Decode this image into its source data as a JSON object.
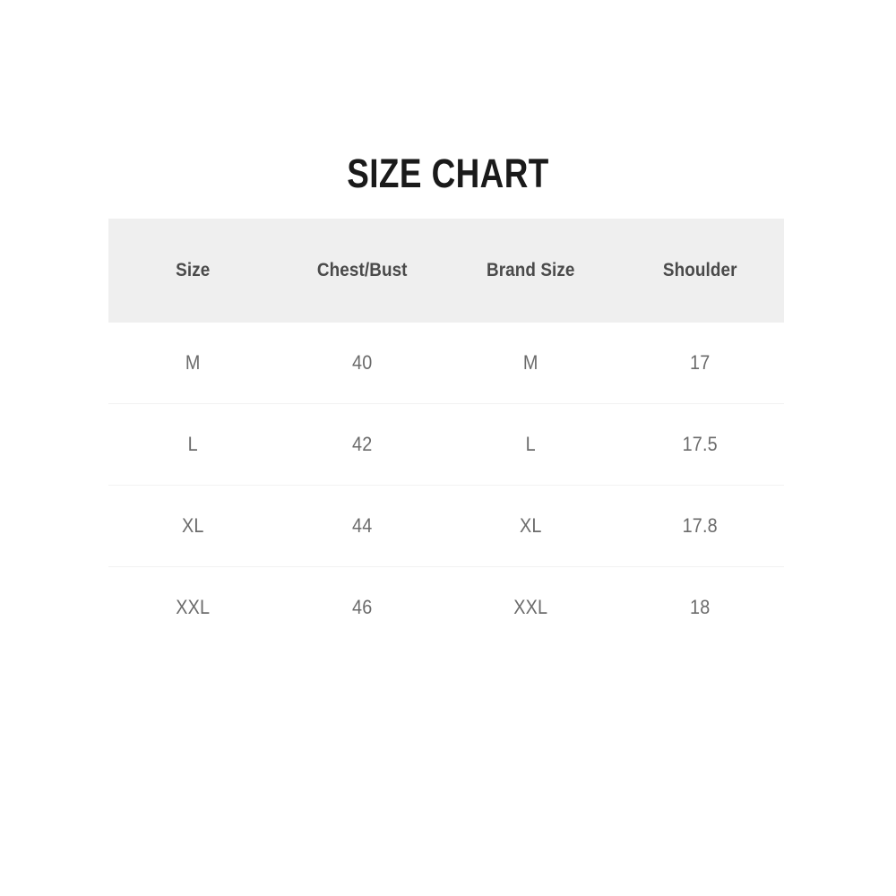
{
  "title": "SIZE CHART",
  "colors": {
    "background": "#ffffff",
    "title_text": "#1a1a1a",
    "header_background": "#efefef",
    "header_text": "#4a4a4a",
    "cell_text": "#6b6b6b",
    "row_divider": "#f2f2f2"
  },
  "table": {
    "columns": [
      "Size",
      "Chest/Bust",
      "Brand Size",
      "Shoulder"
    ],
    "rows": [
      {
        "size": "M",
        "chest_bust": "40",
        "brand_size": "M",
        "shoulder": "17"
      },
      {
        "size": "L",
        "chest_bust": "42",
        "brand_size": "L",
        "shoulder": "17.5"
      },
      {
        "size": "XL",
        "chest_bust": "44",
        "brand_size": "XL",
        "shoulder": "17.8"
      },
      {
        "size": "XXL",
        "chest_bust": "46",
        "brand_size": "XXL",
        "shoulder": "18"
      }
    ]
  },
  "chart_data": {
    "type": "table",
    "title": "SIZE CHART",
    "columns": [
      "Size",
      "Chest/Bust",
      "Brand Size",
      "Shoulder"
    ],
    "rows": [
      [
        "M",
        "40",
        "M",
        "17"
      ],
      [
        "L",
        "42",
        "L",
        "17.5"
      ],
      [
        "XL",
        "44",
        "XL",
        "17.8"
      ],
      [
        "XXL",
        "46",
        "XXL",
        "18"
      ]
    ],
    "series": [
      {
        "name": "Chest/Bust",
        "categories": [
          "M",
          "L",
          "XL",
          "XXL"
        ],
        "values": [
          40,
          42,
          44,
          46
        ]
      },
      {
        "name": "Shoulder",
        "categories": [
          "M",
          "L",
          "XL",
          "XXL"
        ],
        "values": [
          17,
          17.5,
          17.8,
          18
        ]
      }
    ],
    "xlabel": "Size",
    "ylabel": "",
    "grid": false,
    "legend": "none"
  }
}
